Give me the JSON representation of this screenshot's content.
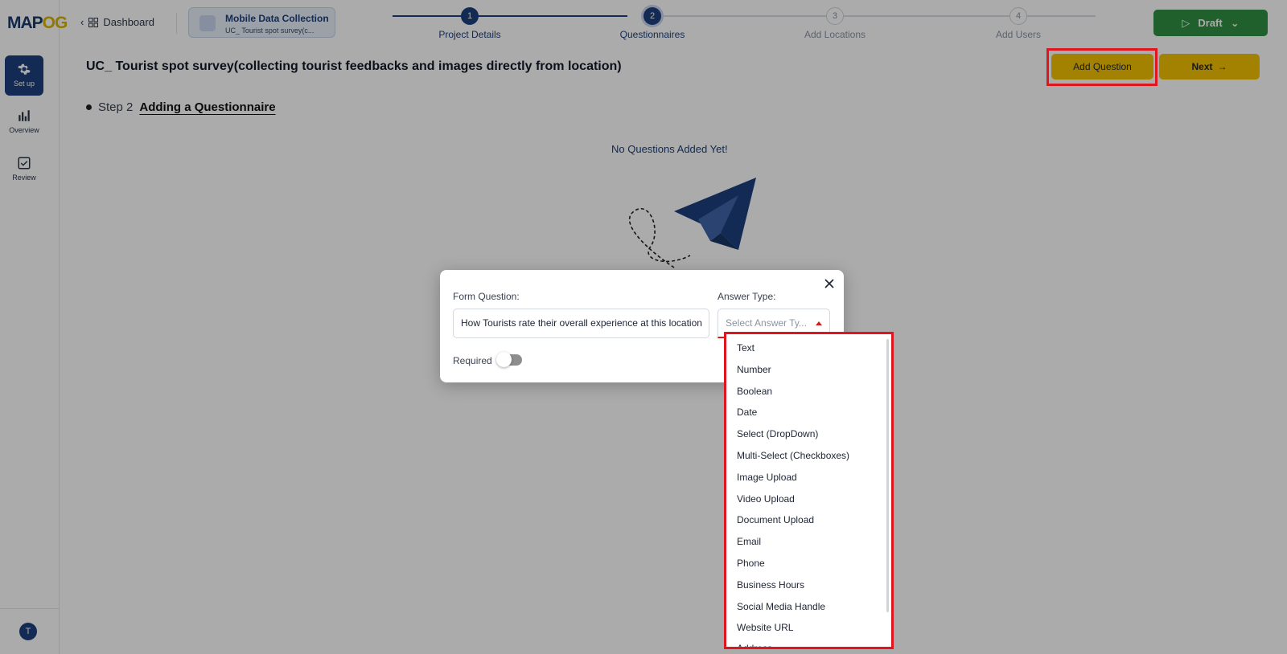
{
  "logo": {
    "part1": "MAP",
    "part2": "OG"
  },
  "sidebar": {
    "items": [
      {
        "label": "Set up",
        "icon": "gear-icon",
        "active": true
      },
      {
        "label": "Overview",
        "icon": "bar-chart-icon",
        "active": false
      },
      {
        "label": "Review",
        "icon": "checkbox-icon",
        "active": false
      }
    ],
    "avatar_initial": "T"
  },
  "topbar": {
    "back_label": "Dashboard",
    "project": {
      "title": "Mobile Data Collection",
      "subtitle": "UC_ Tourist spot survey(c..."
    },
    "steps": [
      {
        "number": "1",
        "label": "Project Details",
        "state": "done"
      },
      {
        "number": "2",
        "label": "Questionnaires",
        "state": "current"
      },
      {
        "number": "3",
        "label": "Add Locations",
        "state": "todo"
      },
      {
        "number": "4",
        "label": "Add Users",
        "state": "todo"
      }
    ],
    "draft_label": "Draft"
  },
  "main": {
    "title": "UC_ Tourist spot survey(collecting tourist feedbacks and images directly from location)",
    "add_question_label": "Add Question",
    "next_label": "Next",
    "step_number": "Step 2",
    "step_title": "Adding a Questionnaire",
    "empty_message": "No Questions Added Yet!"
  },
  "modal": {
    "form_question_label": "Form Question:",
    "form_question_value": "How Tourists rate their overall experience at this location",
    "answer_type_label": "Answer Type:",
    "answer_type_placeholder": "Select Answer Ty...",
    "required_label": "Required",
    "required_on": false
  },
  "dropdown": {
    "options": [
      "Text",
      "Number",
      "Boolean",
      "Date",
      "Select (DropDown)",
      "Multi-Select (Checkboxes)",
      "Image Upload",
      "Video Upload",
      "Document Upload",
      "Email",
      "Phone",
      "Business Hours",
      "Social Media Handle",
      "Website URL",
      "Address"
    ]
  },
  "colors": {
    "primary": "#1b3f7e",
    "accent": "#f2c200",
    "draft": "#2f8f43",
    "highlight": "#e0161e"
  }
}
